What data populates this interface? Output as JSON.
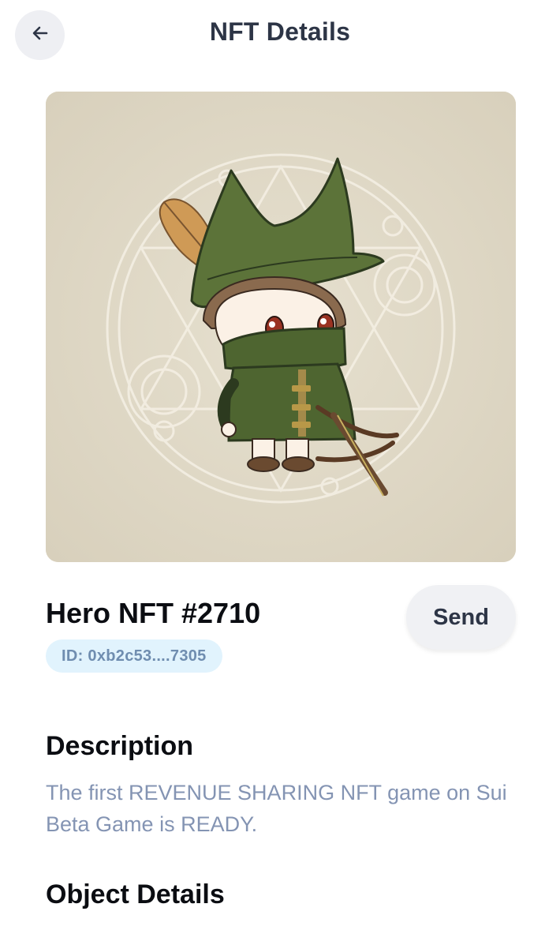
{
  "header": {
    "back_icon": "arrow-left-icon",
    "title": "NFT Details"
  },
  "nft": {
    "image_alt": "Hero NFT artwork",
    "name": "Hero NFT #2710",
    "id_label": "ID: 0xb2c53....7305",
    "send_label": "Send"
  },
  "description": {
    "title": "Description",
    "text": "The first REVENUE SHARING NFT game on Sui Beta Game is READY."
  },
  "object_details": {
    "title": "Object Details"
  },
  "colors": {
    "header_text": "#2d3546",
    "badge_bg": "#e1f3fd",
    "badge_text": "#6f8db0",
    "description_text": "#8494b3",
    "image_bg": "#ddd6c4"
  }
}
